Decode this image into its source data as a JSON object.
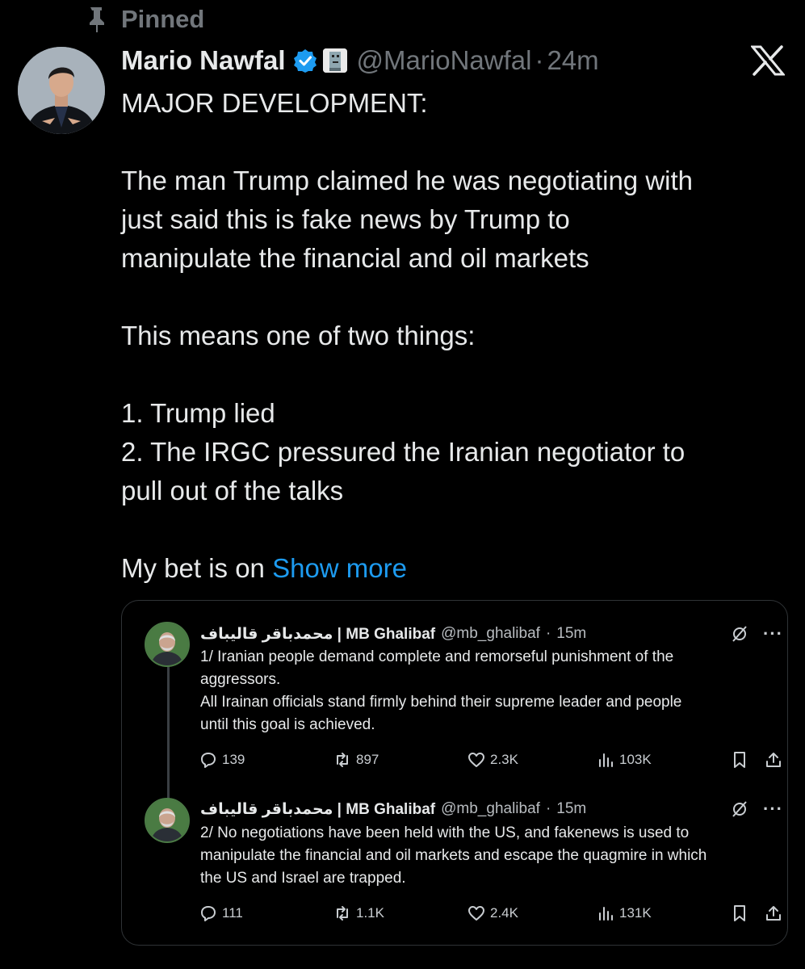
{
  "pinned": {
    "label": "Pinned",
    "icon": "pin-icon"
  },
  "tweet": {
    "author_name": "Mario Nawfal",
    "handle": "@MarioNawfal",
    "separator": "·",
    "time": "24m",
    "lines": [
      "MAJOR DEVELOPMENT:",
      "",
      "The man Trump claimed he was negotiating with",
      "just said this is fake news by Trump to",
      "manipulate the financial and oil markets",
      "",
      "This means one of two things:",
      "",
      "1. Trump lied",
      "2. The IRGC pressured the Iranian negotiator to",
      "pull out of the talks",
      ""
    ],
    "last_line_prefix": "My bet is on ",
    "show_more": "Show more",
    "colors": {
      "accent": "#1d9bf0",
      "verified": "#1d9bf0",
      "muted": "#71767b"
    }
  },
  "quoted": [
    {
      "name": "محمدباقر قالیباف | MB Ghalibaf",
      "handle": "@mb_ghalibaf",
      "separator": "·",
      "time": "15m",
      "lines": [
        "1/ Iranian people demand complete and remorseful punishment of the",
        "aggressors.",
        "All Irainan officials stand firmly behind their supreme leader and people",
        "until this goal is achieved."
      ],
      "replies": "139",
      "reposts": "897",
      "likes": "2.3K",
      "views": "103K",
      "more": "···"
    },
    {
      "name": "محمدباقر قالیباف | MB Ghalibaf",
      "handle": "@mb_ghalibaf",
      "separator": "·",
      "time": "15m",
      "lines": [
        "2/ No negotiations have been held with the US, and fakenews is used to",
        "manipulate the financial and oil markets and escape the quagmire in which",
        "the US and Israel are trapped."
      ],
      "replies": "111",
      "reposts": "1.1K",
      "likes": "2.4K",
      "views": "131K",
      "more": "···"
    }
  ]
}
